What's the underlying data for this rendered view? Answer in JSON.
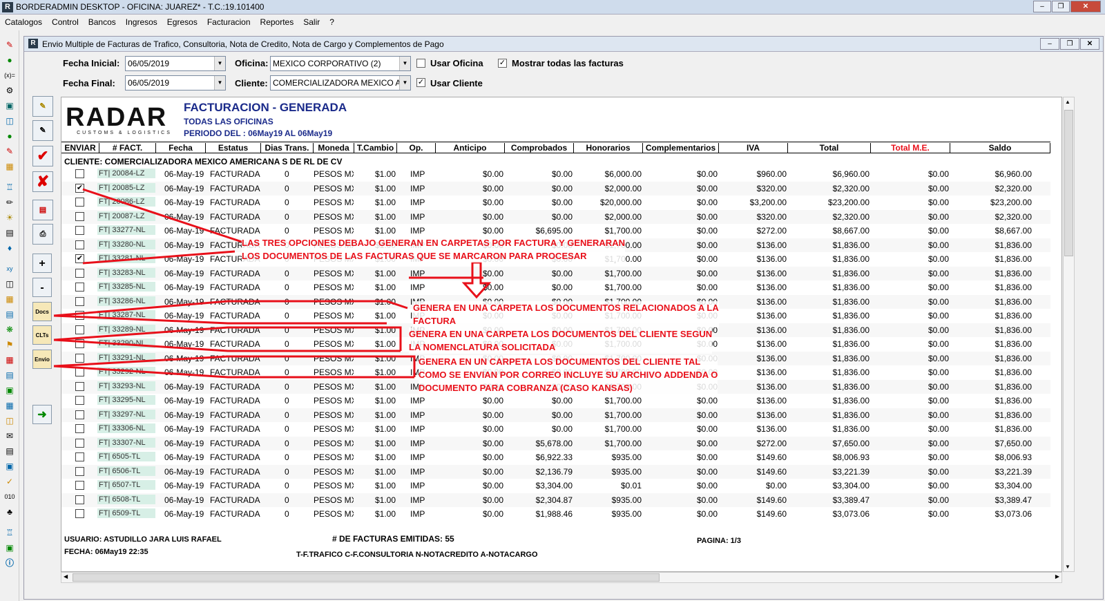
{
  "app": {
    "title": "BORDERADMIN DESKTOP - OFICINA: JUAREZ* -   T.C.:19.101400"
  },
  "menu": [
    "Catalogos",
    "Control",
    "Bancos",
    "Ingresos",
    "Egresos",
    "Facturacion",
    "Reportes",
    "Salir",
    "?"
  ],
  "window": {
    "title": "Envio Multiple de Facturas de Trafico, Consultoria, Nota de Credito, Nota de Cargo y Complementos de Pago"
  },
  "filters": {
    "fecha_inicial_label": "Fecha Inicial:",
    "fecha_inicial": "06/05/2019",
    "fecha_final_label": "Fecha Final:",
    "fecha_final": "06/05/2019",
    "oficina_label": "Oficina:",
    "oficina": "MEXICO CORPORATIVO (2)",
    "cliente_label": "Cliente:",
    "cliente": "COMERCIALIZADORA MEXICO AM",
    "usar_oficina": "Usar Oficina",
    "mostrar_todas": "Mostrar todas las facturas",
    "usar_cliente": "Usar Cliente"
  },
  "toolbar": {
    "plus": "+",
    "minus": "-",
    "docs": "Docs",
    "clts": "CLTs",
    "envio": "Envio"
  },
  "report": {
    "logo": "RADAR",
    "logo_sub": "CUSTOMS & LOGISTICS",
    "title": "FACTURACION - GENERADA",
    "subtitle": "TODAS LAS OFICINAS",
    "period": "PERIODO DEL : 06May19 AL 06May19",
    "columns": [
      "ENVIAR",
      "# FACT.",
      "Fecha",
      "Estatus",
      "Dias Trans.",
      "Moneda",
      "T.Cambio",
      "Op.",
      "Anticipo",
      "Comprobados",
      "Honorarios",
      "Complementarios",
      "IVA",
      "Total",
      "Total M.E.",
      "Saldo"
    ],
    "client": "CLIENTE: COMERCIALIZADORA MEXICO AMERICANA S DE RL DE CV",
    "rows": [
      {
        "chk": "",
        "fact": "FT| 20084-LZ",
        "fecha": "06-May-19",
        "est": "FACTURADA",
        "dias": "0",
        "mon": "PESOS MX",
        "tc": "$1.00",
        "op": "IMP",
        "ant": "$0.00",
        "comp": "$0.00",
        "hon": "$6,000.00",
        "compl": "$0.00",
        "iva": "$960.00",
        "tot": "$6,960.00",
        "tme": "$0.00",
        "saldo": "$6,960.00"
      },
      {
        "chk": "✔",
        "fact": "FT| 20085-LZ",
        "fecha": "06-May-19",
        "est": "FACTURADA",
        "dias": "0",
        "mon": "PESOS MX",
        "tc": "$1.00",
        "op": "IMP",
        "ant": "$0.00",
        "comp": "$0.00",
        "hon": "$2,000.00",
        "compl": "$0.00",
        "iva": "$320.00",
        "tot": "$2,320.00",
        "tme": "$0.00",
        "saldo": "$2,320.00"
      },
      {
        "chk": "",
        "fact": "FT| 20086-LZ",
        "fecha": "06-May-19",
        "est": "FACTURADA",
        "dias": "0",
        "mon": "PESOS MX",
        "tc": "$1.00",
        "op": "IMP",
        "ant": "$0.00",
        "comp": "$0.00",
        "hon": "$20,000.00",
        "compl": "$0.00",
        "iva": "$3,200.00",
        "tot": "$23,200.00",
        "tme": "$0.00",
        "saldo": "$23,200.00"
      },
      {
        "chk": "",
        "fact": "FT| 20087-LZ",
        "fecha": "06-May-19",
        "est": "FACTURADA",
        "dias": "0",
        "mon": "PESOS MX",
        "tc": "$1.00",
        "op": "IMP",
        "ant": "$0.00",
        "comp": "$0.00",
        "hon": "$2,000.00",
        "compl": "$0.00",
        "iva": "$320.00",
        "tot": "$2,320.00",
        "tme": "$0.00",
        "saldo": "$2,320.00"
      },
      {
        "chk": "",
        "fact": "FT| 33277-NL",
        "fecha": "06-May-19",
        "est": "FACTURADA",
        "dias": "0",
        "mon": "PESOS MX",
        "tc": "$1.00",
        "op": "IMP",
        "ant": "$0.00",
        "comp": "$6,695.00",
        "hon": "$1,700.00",
        "compl": "$0.00",
        "iva": "$272.00",
        "tot": "$8,667.00",
        "tme": "$0.00",
        "saldo": "$8,667.00"
      },
      {
        "chk": "",
        "fact": "FT| 33280-NL",
        "fecha": "06-May-19",
        "est": "FACTURADA",
        "dias": "0",
        "mon": "PESOS MX",
        "tc": "$1.00",
        "op": "IMP",
        "ant": "$0.00",
        "comp": "$0.00",
        "hon": "$1,700.00",
        "compl": "$0.00",
        "iva": "$136.00",
        "tot": "$1,836.00",
        "tme": "$0.00",
        "saldo": "$1,836.00"
      },
      {
        "chk": "✔",
        "fact": "FT| 33281-NL",
        "fecha": "06-May-19",
        "est": "FACTURADA",
        "dias": "0",
        "mon": "PESOS MX",
        "tc": "$1.00",
        "op": "IMP",
        "ant": "$0.00",
        "comp": "$0.00",
        "hon": "$1,700.00",
        "compl": "$0.00",
        "iva": "$136.00",
        "tot": "$1,836.00",
        "tme": "$0.00",
        "saldo": "$1,836.00"
      },
      {
        "chk": "",
        "fact": "FT| 33283-NL",
        "fecha": "06-May-19",
        "est": "FACTURADA",
        "dias": "0",
        "mon": "PESOS MX",
        "tc": "$1.00",
        "op": "IMP",
        "ant": "$0.00",
        "comp": "$0.00",
        "hon": "$1,700.00",
        "compl": "$0.00",
        "iva": "$136.00",
        "tot": "$1,836.00",
        "tme": "$0.00",
        "saldo": "$1,836.00"
      },
      {
        "chk": "",
        "fact": "FT| 33285-NL",
        "fecha": "06-May-19",
        "est": "FACTURADA",
        "dias": "0",
        "mon": "PESOS MX",
        "tc": "$1.00",
        "op": "IMP",
        "ant": "$0.00",
        "comp": "$0.00",
        "hon": "$1,700.00",
        "compl": "$0.00",
        "iva": "$136.00",
        "tot": "$1,836.00",
        "tme": "$0.00",
        "saldo": "$1,836.00"
      },
      {
        "chk": "",
        "fact": "FT| 33286-NL",
        "fecha": "06-May-19",
        "est": "FACTURADA",
        "dias": "0",
        "mon": "PESOS MX",
        "tc": "$1.00",
        "op": "IMP",
        "ant": "$0.00",
        "comp": "$0.00",
        "hon": "$1,700.00",
        "compl": "$0.00",
        "iva": "$136.00",
        "tot": "$1,836.00",
        "tme": "$0.00",
        "saldo": "$1,836.00"
      },
      {
        "chk": "",
        "fact": "FT| 33287-NL",
        "fecha": "06-May-19",
        "est": "FACTURADA",
        "dias": "0",
        "mon": "PESOS MX",
        "tc": "$1.00",
        "op": "IMP",
        "ant": "$0.00",
        "comp": "$0.00",
        "hon": "$1,700.00",
        "compl": "$0.00",
        "iva": "$136.00",
        "tot": "$1,836.00",
        "tme": "$0.00",
        "saldo": "$1,836.00"
      },
      {
        "chk": "",
        "fact": "FT| 33289-NL",
        "fecha": "06-May-19",
        "est": "FACTURADA",
        "dias": "0",
        "mon": "PESOS MX",
        "tc": "$1.00",
        "op": "IMP",
        "ant": "$0.00",
        "comp": "$0.00",
        "hon": "$1,700.00",
        "compl": "$0.00",
        "iva": "$136.00",
        "tot": "$1,836.00",
        "tme": "$0.00",
        "saldo": "$1,836.00"
      },
      {
        "chk": "",
        "fact": "FT| 33290-NL",
        "fecha": "06-May-19",
        "est": "FACTURADA",
        "dias": "0",
        "mon": "PESOS MX",
        "tc": "$1.00",
        "op": "IMP",
        "ant": "$0.00",
        "comp": "$0.00",
        "hon": "$1,700.00",
        "compl": "$0.00",
        "iva": "$136.00",
        "tot": "$1,836.00",
        "tme": "$0.00",
        "saldo": "$1,836.00"
      },
      {
        "chk": "",
        "fact": "FT| 33291-NL",
        "fecha": "06-May-19",
        "est": "FACTURADA",
        "dias": "0",
        "mon": "PESOS MX",
        "tc": "$1.00",
        "op": "IMP",
        "ant": "$0.00",
        "comp": "$0.00",
        "hon": "$1,700.00",
        "compl": "$0.00",
        "iva": "$136.00",
        "tot": "$1,836.00",
        "tme": "$0.00",
        "saldo": "$1,836.00"
      },
      {
        "chk": "",
        "fact": "FT| 33292-NL",
        "fecha": "06-May-19",
        "est": "FACTURADA",
        "dias": "0",
        "mon": "PESOS MX",
        "tc": "$1.00",
        "op": "IMP",
        "ant": "$0.00",
        "comp": "$0.00",
        "hon": "$1,700.00",
        "compl": "$0.00",
        "iva": "$136.00",
        "tot": "$1,836.00",
        "tme": "$0.00",
        "saldo": "$1,836.00"
      },
      {
        "chk": "",
        "fact": "FT| 33293-NL",
        "fecha": "06-May-19",
        "est": "FACTURADA",
        "dias": "0",
        "mon": "PESOS MX",
        "tc": "$1.00",
        "op": "IMP",
        "ant": "$0.00",
        "comp": "$0.00",
        "hon": "$1,700.00",
        "compl": "$0.00",
        "iva": "$136.00",
        "tot": "$1,836.00",
        "tme": "$0.00",
        "saldo": "$1,836.00"
      },
      {
        "chk": "",
        "fact": "FT| 33295-NL",
        "fecha": "06-May-19",
        "est": "FACTURADA",
        "dias": "0",
        "mon": "PESOS MX",
        "tc": "$1.00",
        "op": "IMP",
        "ant": "$0.00",
        "comp": "$0.00",
        "hon": "$1,700.00",
        "compl": "$0.00",
        "iva": "$136.00",
        "tot": "$1,836.00",
        "tme": "$0.00",
        "saldo": "$1,836.00"
      },
      {
        "chk": "",
        "fact": "FT| 33297-NL",
        "fecha": "06-May-19",
        "est": "FACTURADA",
        "dias": "0",
        "mon": "PESOS MX",
        "tc": "$1.00",
        "op": "IMP",
        "ant": "$0.00",
        "comp": "$0.00",
        "hon": "$1,700.00",
        "compl": "$0.00",
        "iva": "$136.00",
        "tot": "$1,836.00",
        "tme": "$0.00",
        "saldo": "$1,836.00"
      },
      {
        "chk": "",
        "fact": "FT| 33306-NL",
        "fecha": "06-May-19",
        "est": "FACTURADA",
        "dias": "0",
        "mon": "PESOS MX",
        "tc": "$1.00",
        "op": "IMP",
        "ant": "$0.00",
        "comp": "$0.00",
        "hon": "$1,700.00",
        "compl": "$0.00",
        "iva": "$136.00",
        "tot": "$1,836.00",
        "tme": "$0.00",
        "saldo": "$1,836.00"
      },
      {
        "chk": "",
        "fact": "FT| 33307-NL",
        "fecha": "06-May-19",
        "est": "FACTURADA",
        "dias": "0",
        "mon": "PESOS MX",
        "tc": "$1.00",
        "op": "IMP",
        "ant": "$0.00",
        "comp": "$5,678.00",
        "hon": "$1,700.00",
        "compl": "$0.00",
        "iva": "$272.00",
        "tot": "$7,650.00",
        "tme": "$0.00",
        "saldo": "$7,650.00"
      },
      {
        "chk": "",
        "fact": "FT| 6505-TL",
        "fecha": "06-May-19",
        "est": "FACTURADA",
        "dias": "0",
        "mon": "PESOS MX",
        "tc": "$1.00",
        "op": "IMP",
        "ant": "$0.00",
        "comp": "$6,922.33",
        "hon": "$935.00",
        "compl": "$0.00",
        "iva": "$149.60",
        "tot": "$8,006.93",
        "tme": "$0.00",
        "saldo": "$8,006.93"
      },
      {
        "chk": "",
        "fact": "FT| 6506-TL",
        "fecha": "06-May-19",
        "est": "FACTURADA",
        "dias": "0",
        "mon": "PESOS MX",
        "tc": "$1.00",
        "op": "IMP",
        "ant": "$0.00",
        "comp": "$2,136.79",
        "hon": "$935.00",
        "compl": "$0.00",
        "iva": "$149.60",
        "tot": "$3,221.39",
        "tme": "$0.00",
        "saldo": "$3,221.39"
      },
      {
        "chk": "",
        "fact": "FT| 6507-TL",
        "fecha": "06-May-19",
        "est": "FACTURADA",
        "dias": "0",
        "mon": "PESOS MX",
        "tc": "$1.00",
        "op": "IMP",
        "ant": "$0.00",
        "comp": "$3,304.00",
        "hon": "$0.01",
        "compl": "$0.00",
        "iva": "$0.00",
        "tot": "$3,304.00",
        "tme": "$0.00",
        "saldo": "$3,304.00"
      },
      {
        "chk": "",
        "fact": "FT| 6508-TL",
        "fecha": "06-May-19",
        "est": "FACTURADA",
        "dias": "0",
        "mon": "PESOS MX",
        "tc": "$1.00",
        "op": "IMP",
        "ant": "$0.00",
        "comp": "$2,304.87",
        "hon": "$935.00",
        "compl": "$0.00",
        "iva": "$149.60",
        "tot": "$3,389.47",
        "tme": "$0.00",
        "saldo": "$3,389.47"
      },
      {
        "chk": "",
        "fact": "FT| 6509-TL",
        "fecha": "06-May-19",
        "est": "FACTURADA",
        "dias": "0",
        "mon": "PESOS MX",
        "tc": "$1.00",
        "op": "IMP",
        "ant": "$0.00",
        "comp": "$1,988.46",
        "hon": "$935.00",
        "compl": "$0.00",
        "iva": "$149.60",
        "tot": "$3,073.06",
        "tme": "$0.00",
        "saldo": "$3,073.06"
      }
    ],
    "usuario": "USUARIO: ASTUDILLO JARA LUIS RAFAEL",
    "fecha": "FECHA: 06May19 22:35",
    "emitidas": "# DE FACTURAS EMITIDAS: 55",
    "pagina": "PAGINA: 1/3",
    "leyenda": "T-F.TRAFICO  C-F.CONSULTORIA  N-NOTACREDITO  A-NOTACARGO"
  },
  "annotations": {
    "a1_l1": "LAS TRES OPCIONES DEBAJO GENERAN EN CARPETAS POR FACTURA Y GENERARAN",
    "a1_l2": "LOS DOCUMENTOS DE LAS FACTURAS QUE SE MARCARON PARA PROCESAR",
    "a2_l1": "GENERA EN UNA CARPETA LOS DOCUMENTOS RELACIONADOS A LA",
    "a2_l2": "FACTURA",
    "a3_l1": "GENERA EN UNA CARPETA LOS DOCUMENTOS DEL CLIENTE SEGUN",
    "a3_l2": "LA NOMENCLATURA SOLICITADA",
    "a4_l1": "GENERA EN UN CARPETA LOS DOCUMENTOS DEL CLIENTE TAL",
    "a4_l2": "COMO SE ENVIAN POR CORREO INCLUYE SU ARCHIVO ADDENDA O",
    "a4_l3": "DOCUMENTO PARA COBRANZA (CASO KANSAS)"
  },
  "colors": {
    "accent": "#1a2a8a",
    "annotation": "#e8101a",
    "fact_bg": "#d7efe6",
    "total_me": "#e8101a"
  }
}
